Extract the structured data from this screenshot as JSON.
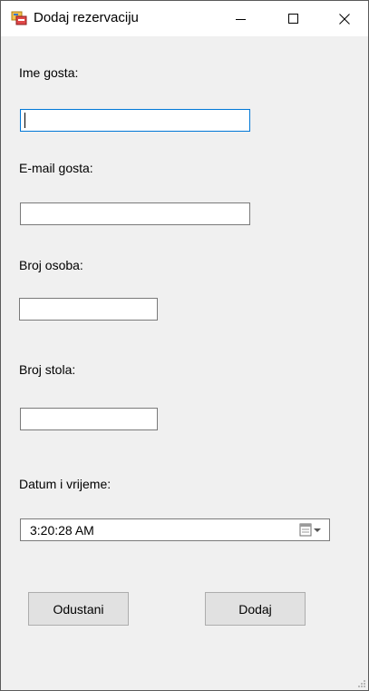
{
  "window": {
    "title": "Dodaj rezervaciju",
    "icon": "form-window-icon",
    "controls": [
      "minimize-icon",
      "maximize-icon",
      "close-icon"
    ]
  },
  "form": {
    "guest_name": {
      "label": "Ime gosta:",
      "value": ""
    },
    "guest_email": {
      "label": "E-mail gosta:",
      "value": ""
    },
    "person_count": {
      "label": "Broj osoba:",
      "value": ""
    },
    "table_number": {
      "label": "Broj stola:",
      "value": ""
    },
    "datetime": {
      "label": "Datum i vrijeme:",
      "value": "3:20:28 AM",
      "icon": "calendar-dropdown-icon"
    }
  },
  "buttons": {
    "cancel": "Odustani",
    "add": "Dodaj"
  },
  "colors": {
    "focus_border": "#0078d7",
    "window_bg": "#f0f0f0",
    "button_bg": "#e1e1e1"
  }
}
